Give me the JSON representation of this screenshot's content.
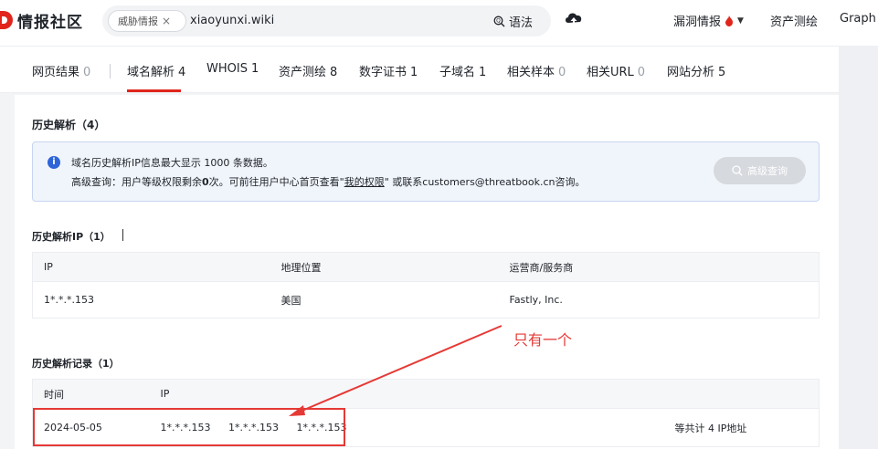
{
  "header": {
    "logo_text": "情报社区",
    "search": {
      "chip_label": "威胁情报",
      "chip_close": "×",
      "query": "xiaoyunxi.wiki",
      "syntax_label": "语法"
    },
    "nav": {
      "vuln": "漏洞情报",
      "asset": "资产测绘",
      "graph": "Graph"
    }
  },
  "tabs": [
    {
      "label": "网页结果",
      "count": "0"
    },
    {
      "label": "域名解析",
      "count": "4"
    },
    {
      "label": "WHOIS",
      "count": "1"
    },
    {
      "label": "资产测绘",
      "count": "8"
    },
    {
      "label": "数字证书",
      "count": "1"
    },
    {
      "label": "子域名",
      "count": "1"
    },
    {
      "label": "相关样本",
      "count": "0"
    },
    {
      "label": "相关URL",
      "count": "0"
    },
    {
      "label": "网站分析",
      "count": "5"
    }
  ],
  "section": {
    "title": "历史解析（4）"
  },
  "notice": {
    "line1": "域名历史解析IP信息最大显示 1000 条数据。",
    "line2_prefix": "高级查询：用户等级权限剩余",
    "line2_count": "0",
    "line2_mid": "次。可前往用户中心首页查看\"",
    "line2_link": "我的权限",
    "line2_suffix": "\" 或联系customers@threatbook.cn咨询。",
    "button": "高级查询"
  },
  "ip_table": {
    "title": "历史解析IP（1）",
    "headers": [
      "IP",
      "地理位置",
      "运营商/服务商"
    ],
    "rows": [
      [
        "1*.*.*.153",
        "美国",
        "Fastly, Inc."
      ]
    ]
  },
  "record_table": {
    "title": "历史解析记录（1）",
    "headers": [
      "时间",
      "IP"
    ],
    "rows": [
      {
        "time": "2024-05-05",
        "ips": [
          "1*.*.*.153",
          "1*.*.*.153",
          "1*.*.*.153"
        ],
        "total": "等共计 4 IP地址"
      }
    ]
  },
  "annotation": {
    "text": "只有一个"
  },
  "colors": {
    "brand_red": "#e1251b",
    "annotation_red": "#e53935",
    "info_blue": "#2d64d8"
  }
}
